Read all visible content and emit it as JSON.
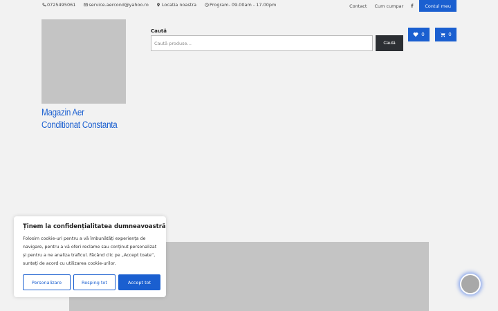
{
  "topbar": {
    "phone": "0725495061",
    "email": "service.aercond@yahoo.ro",
    "location": "Locatia noastra",
    "hours": "Program- 09.00am - 17.00pm",
    "links": [
      "Contact",
      "Cum cumpar"
    ],
    "facebook": "f",
    "account_label": "Contul meu"
  },
  "header": {
    "site_title": "Magazin Aer Conditionat Constanta",
    "search_label": "Caută",
    "search_placeholder": "Caută produse…",
    "search_button": "Caută",
    "wishlist_count": "0",
    "cart_count": "0"
  },
  "cookie_banner": {
    "title": "Ținem la confidențialitatea dumneavoastră",
    "text": "Folosim cookie-uri pentru a vă îmbunătăți experiența de navigare, pentru a vă oferi reclame sau conținut personalizat și pentru a ne analiza traficul. Făcând clic pe „Accept toate”, sunteți de acord cu utilizarea cookie-urilor.",
    "customize_label": "Personalizare",
    "reject_label": "Resping tot",
    "accept_label": "Accept tot"
  },
  "colors": {
    "accent": "#1a5fd0",
    "dark_button": "#2c2f33",
    "page_bg": "#f2f2f2",
    "placeholder_gray": "#c4c4c4"
  },
  "icons": [
    "phone-icon",
    "mail-icon",
    "map-marker-icon",
    "clock-icon",
    "facebook-icon",
    "heart-icon",
    "cart-icon"
  ]
}
